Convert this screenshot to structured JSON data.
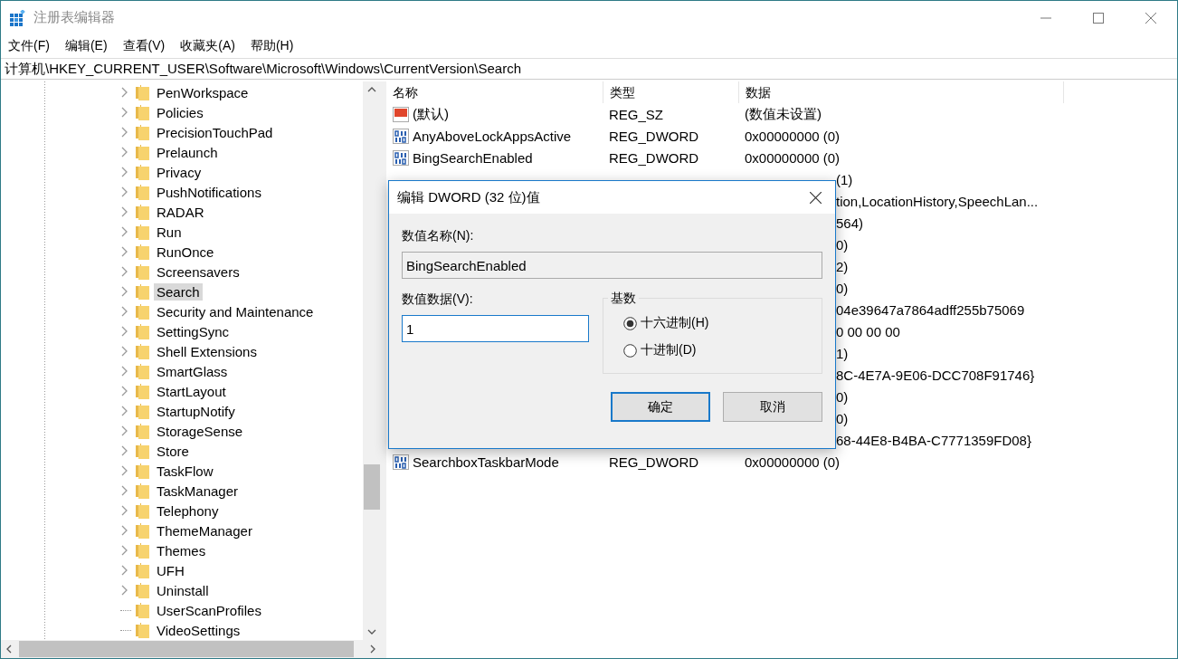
{
  "window": {
    "title": "注册表编辑器"
  },
  "menu": [
    {
      "label": "文件(F)"
    },
    {
      "label": "编辑(E)"
    },
    {
      "label": "查看(V)"
    },
    {
      "label": "收藏夹(A)"
    },
    {
      "label": "帮助(H)"
    }
  ],
  "address": "计算机\\HKEY_CURRENT_USER\\Software\\Microsoft\\Windows\\CurrentVersion\\Search",
  "tree": [
    {
      "label": "PenWorkspace",
      "expandable": true,
      "selected": false
    },
    {
      "label": "Policies",
      "expandable": true,
      "selected": false
    },
    {
      "label": "PrecisionTouchPad",
      "expandable": true,
      "selected": false
    },
    {
      "label": "Prelaunch",
      "expandable": true,
      "selected": false
    },
    {
      "label": "Privacy",
      "expandable": true,
      "selected": false
    },
    {
      "label": "PushNotifications",
      "expandable": true,
      "selected": false
    },
    {
      "label": "RADAR",
      "expandable": true,
      "selected": false
    },
    {
      "label": "Run",
      "expandable": true,
      "selected": false
    },
    {
      "label": "RunOnce",
      "expandable": true,
      "selected": false
    },
    {
      "label": "Screensavers",
      "expandable": true,
      "selected": false
    },
    {
      "label": "Search",
      "expandable": true,
      "selected": true
    },
    {
      "label": "Security and Maintenance",
      "expandable": true,
      "selected": false
    },
    {
      "label": "SettingSync",
      "expandable": true,
      "selected": false
    },
    {
      "label": "Shell Extensions",
      "expandable": true,
      "selected": false
    },
    {
      "label": "SmartGlass",
      "expandable": true,
      "selected": false
    },
    {
      "label": "StartLayout",
      "expandable": true,
      "selected": false
    },
    {
      "label": "StartupNotify",
      "expandable": true,
      "selected": false
    },
    {
      "label": "StorageSense",
      "expandable": true,
      "selected": false
    },
    {
      "label": "Store",
      "expandable": true,
      "selected": false
    },
    {
      "label": "TaskFlow",
      "expandable": true,
      "selected": false
    },
    {
      "label": "TaskManager",
      "expandable": true,
      "selected": false
    },
    {
      "label": "Telephony",
      "expandable": true,
      "selected": false
    },
    {
      "label": "ThemeManager",
      "expandable": true,
      "selected": false
    },
    {
      "label": "Themes",
      "expandable": true,
      "selected": false
    },
    {
      "label": "UFH",
      "expandable": true,
      "selected": false
    },
    {
      "label": "Uninstall",
      "expandable": true,
      "selected": false
    },
    {
      "label": "UserScanProfiles",
      "expandable": false,
      "selected": false
    },
    {
      "label": "VideoSettings",
      "expandable": false,
      "selected": false
    }
  ],
  "table": {
    "columns": [
      "名称",
      "类型",
      "数据"
    ],
    "rows": [
      {
        "kind": "string",
        "name": "(默认)",
        "type": "REG_SZ",
        "data": "(数值未设置)"
      },
      {
        "kind": "binary",
        "name": "AnyAboveLockAppsActive",
        "type": "REG_DWORD",
        "data": "0x00000000 (0)"
      },
      {
        "kind": "binary",
        "name": "BingSearchEnabled",
        "type": "REG_DWORD",
        "data": "0x00000000 (0)"
      },
      {
        "kind": "covered",
        "data": "(1)"
      },
      {
        "kind": "covered",
        "data": "tion,LocationHistory,SpeechLan..."
      },
      {
        "kind": "covered",
        "data": "564)"
      },
      {
        "kind": "covered",
        "data": "0)"
      },
      {
        "kind": "covered",
        "data": "2)"
      },
      {
        "kind": "covered",
        "data": "0)"
      },
      {
        "kind": "covered",
        "data": "04e39647a7864adff255b75069"
      },
      {
        "kind": "covered",
        "data": "0 00 00 00"
      },
      {
        "kind": "covered",
        "data": "1)"
      },
      {
        "kind": "covered",
        "data": "8C-4E7A-9E06-DCC708F91746}"
      },
      {
        "kind": "covered",
        "data": "0)"
      },
      {
        "kind": "covered",
        "data": "0)"
      },
      {
        "kind": "covered",
        "data": "68-44E8-B4BA-C7771359FD08}"
      },
      {
        "kind": "binary",
        "name": "SearchboxTaskbarMode",
        "type": "REG_DWORD",
        "data": "0x00000000 (0)"
      }
    ]
  },
  "dialog": {
    "title": "编辑 DWORD (32 位)值",
    "name_label": "数值名称(N):",
    "name_value": "BingSearchEnabled",
    "data_label": "数值数据(V):",
    "data_value": "1",
    "base_label": "基数",
    "radios": [
      {
        "label": "十六进制(H)",
        "selected": true
      },
      {
        "label": "十进制(D)",
        "selected": false
      }
    ],
    "buttons": [
      {
        "label": "确定",
        "default": true
      },
      {
        "label": "取消",
        "default": false
      }
    ]
  }
}
